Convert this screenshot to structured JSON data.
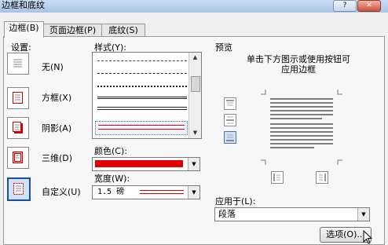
{
  "window": {
    "title": "边框和底纹"
  },
  "tabs": [
    {
      "label": "边框(B)"
    },
    {
      "label": "页面边框(P)"
    },
    {
      "label": "底纹(S)"
    }
  ],
  "settings": {
    "heading": "设置:",
    "items": [
      {
        "label": "无(N)"
      },
      {
        "label": "方框(X)"
      },
      {
        "label": "阴影(A)"
      },
      {
        "label": "三维(D)"
      },
      {
        "label": "自定义(U)"
      }
    ],
    "selected": "自定义(U)"
  },
  "style": {
    "label": "样式(Y):"
  },
  "color": {
    "label": "颜色(C):",
    "value_hex": "#e30000"
  },
  "width": {
    "label": "宽度(W):",
    "value": "1.5 磅"
  },
  "preview": {
    "heading": "预览",
    "hint": "单击下方图示或使用按钮可\n应用边框"
  },
  "apply_to": {
    "label": "应用于(L):",
    "value": "段落"
  },
  "buttons": {
    "options": "选项(O)..."
  },
  "colors": {
    "accent_red": "#e30000",
    "selection_blue": "#cfe1f8"
  }
}
